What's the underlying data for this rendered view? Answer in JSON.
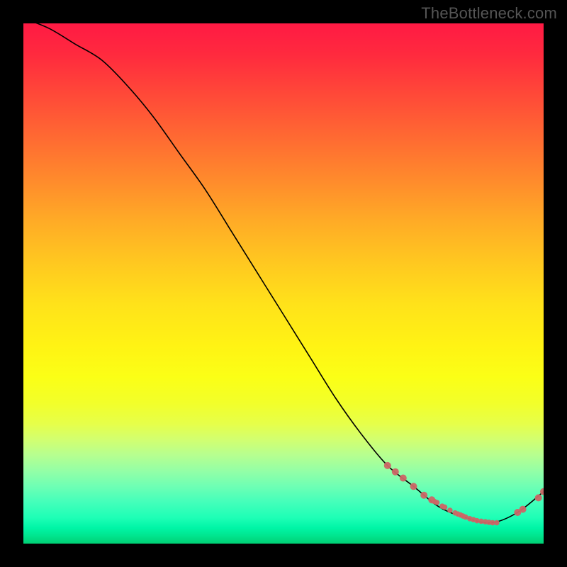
{
  "watermark": "TheBottleneck.com",
  "chart_data": {
    "type": "line",
    "title": "",
    "xlabel": "",
    "ylabel": "",
    "xlim": [
      0,
      100
    ],
    "ylim": [
      0,
      100
    ],
    "grid": false,
    "legend": false,
    "series": [
      {
        "name": "bottleneck-curve",
        "color": "#000000",
        "x": [
          0,
          5,
          10,
          15,
          20,
          25,
          30,
          35,
          40,
          45,
          50,
          55,
          60,
          65,
          70,
          75,
          80,
          85,
          90,
          95,
          100
        ],
        "y": [
          101,
          99,
          96,
          93,
          88,
          82,
          75,
          68,
          60,
          52,
          44,
          36,
          28,
          21,
          15,
          11,
          7,
          5,
          4,
          6,
          10
        ]
      },
      {
        "name": "highlighted-points",
        "type": "scatter",
        "color": "#cc6666",
        "x": [
          70,
          71.5,
          73,
          75,
          77,
          78.5,
          79,
          79.5,
          80.5,
          81,
          82,
          83,
          83.5,
          84,
          84.5,
          85,
          85.8,
          86.5,
          87.2,
          88,
          88.8,
          89.5,
          90.2,
          91,
          95,
          96,
          99,
          100
        ],
        "y": [
          15,
          13.8,
          12.6,
          11,
          9.3,
          8.4,
          8.1,
          7.9,
          7.2,
          7.0,
          6.4,
          5.9,
          5.7,
          5.5,
          5.3,
          5.1,
          4.8,
          4.6,
          4.4,
          4.3,
          4.2,
          4.1,
          4.0,
          4.0,
          6.0,
          6.6,
          8.8,
          10.0
        ]
      }
    ],
    "gradient_stops": [
      {
        "pos": 0.0,
        "color": "#ff1a44"
      },
      {
        "pos": 0.25,
        "color": "#ff7a30"
      },
      {
        "pos": 0.5,
        "color": "#ffd81c"
      },
      {
        "pos": 0.7,
        "color": "#f8ff20"
      },
      {
        "pos": 0.85,
        "color": "#a0ff9a"
      },
      {
        "pos": 1.0,
        "color": "#00d074"
      }
    ]
  }
}
